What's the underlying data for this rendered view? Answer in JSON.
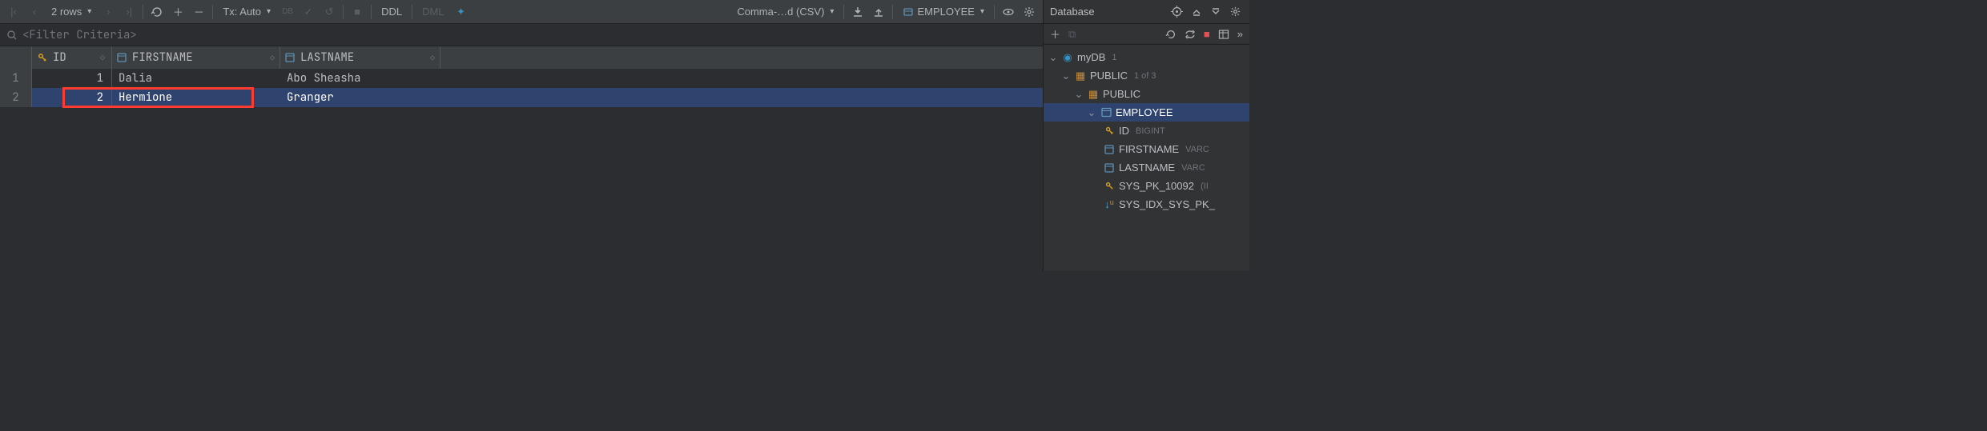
{
  "toolbar": {
    "row_count_label": "2 rows",
    "tx_label": "Tx: Auto",
    "ddl_label": "DDL",
    "dml_label": "DML",
    "format_label": "Comma-…d (CSV)",
    "context_label": "EMPLOYEE"
  },
  "filter": {
    "placeholder": "<Filter Criteria>"
  },
  "columns": {
    "id": "ID",
    "firstname": "FIRSTNAME",
    "lastname": "LASTNAME"
  },
  "rows": [
    {
      "n": "1",
      "id": "1",
      "first": "Dalia",
      "last": "Abo Sheasha"
    },
    {
      "n": "2",
      "id": "2",
      "first": "Hermione",
      "last": "Granger"
    }
  ],
  "db_panel": {
    "title": "Database",
    "datasource": "myDB",
    "datasource_badge": "1",
    "schema_root": "PUBLIC",
    "schema_root_badge": "1 of 3",
    "schema": "PUBLIC",
    "table": "EMPLOYEE",
    "cols": [
      {
        "name": "ID",
        "type": "BIGINT",
        "kind": "pk"
      },
      {
        "name": "FIRSTNAME",
        "type": "VARC",
        "kind": "col"
      },
      {
        "name": "LASTNAME",
        "type": "VARC",
        "kind": "col"
      },
      {
        "name": "SYS_PK_10092",
        "type": "(II",
        "kind": "key"
      },
      {
        "name": "SYS_IDX_SYS_PK_",
        "type": "",
        "kind": "idx"
      }
    ]
  }
}
